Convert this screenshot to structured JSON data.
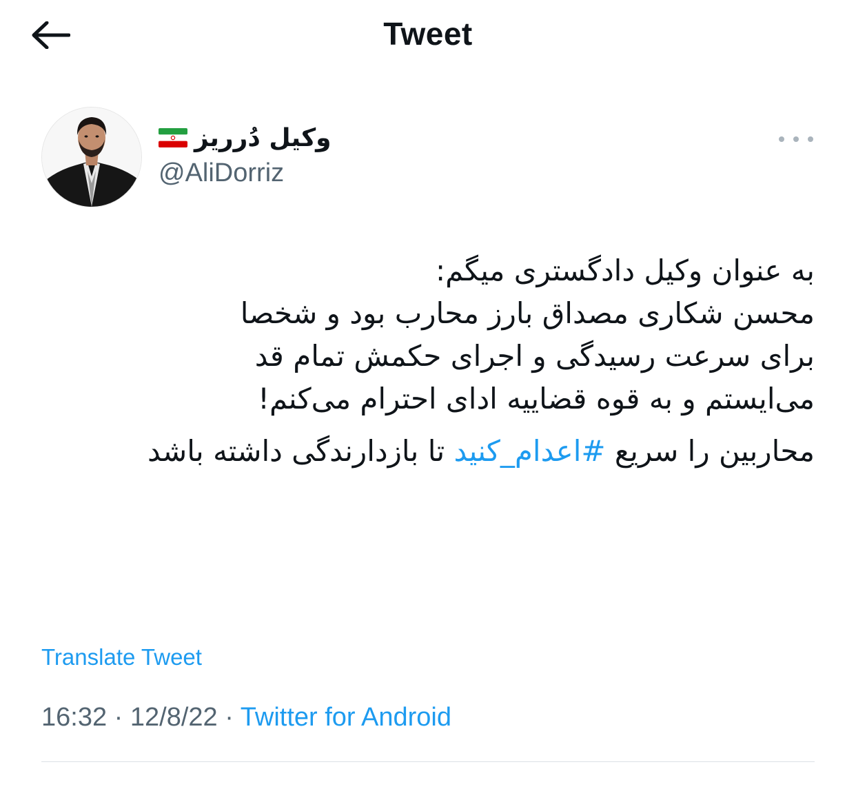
{
  "header": {
    "title": "Tweet",
    "back_icon": "arrow-left-icon"
  },
  "author": {
    "display_name": "وکیل دُرریز",
    "flag_icon": "iran-flag-icon",
    "handle": "@AliDorriz"
  },
  "more_icon": "ellipsis-icon",
  "tweet": {
    "lines": [
      "به عنوان وکیل دادگستری میگم:",
      "محسن شکاری مصداق بارز محارب بود و شخصا",
      "برای سرعت رسیدگی و اجرای حکمش تمام قد",
      "می‌ایستم و به قوه قضاییه ادای احترام می‌کنم!"
    ],
    "para2_before": "محاربین را سریع ",
    "hashtag": "#اعدام_کنید",
    "para2_after": " تا بازدارندگی داشته باشد"
  },
  "translate_label": "Translate Tweet",
  "meta": {
    "time": "16:32",
    "separator": " · ",
    "date": "12/8/22",
    "source": "Twitter for Android"
  },
  "colors": {
    "link": "#1d9bf0",
    "secondary_text": "#536471",
    "primary_text": "#0f1419"
  }
}
